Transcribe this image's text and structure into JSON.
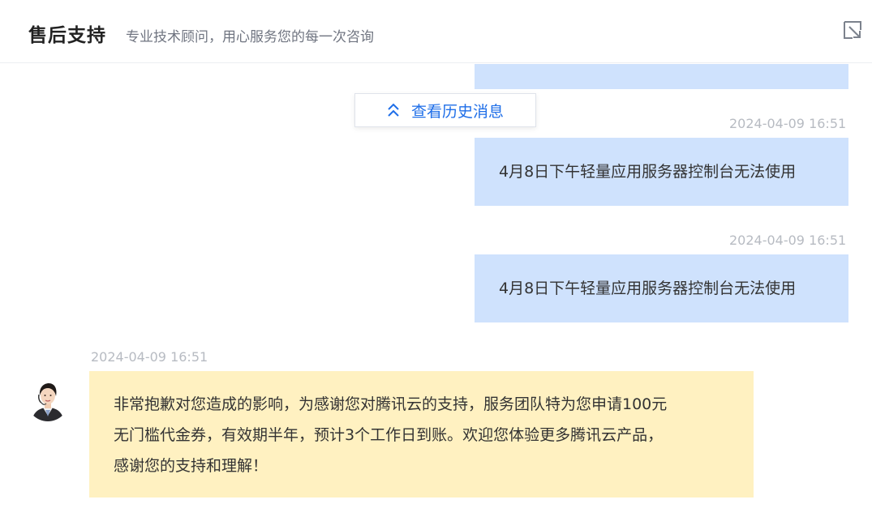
{
  "header": {
    "title": "售后支持",
    "subtitle": "专业技术顾问，用心服务您的每一次咨询",
    "minimize_icon": "minimize-icon"
  },
  "history_button": {
    "label": "查看历史消息",
    "icon": "double-chevron-up-icon"
  },
  "messages": [
    {
      "sender": "user",
      "timestamp": "2024-04-09 16:51",
      "text": "4月8日下午轻量应用服务器控制台无法使用"
    },
    {
      "sender": "user",
      "timestamp": "2024-04-09 16:51",
      "text": "4月8日下午轻量应用服务器控制台无法使用"
    },
    {
      "sender": "agent",
      "timestamp": "2024-04-09 16:51",
      "lines": [
        "非常抱歉对您造成的影响，为感谢您对腾讯云的支持，服务团队特为您申请100元",
        "无门槛代金券，有效期半年，预计3个工作日到账。欢迎您体验更多腾讯云产品，",
        "感谢您的支持和理解！"
      ]
    }
  ],
  "colors": {
    "user_bubble": "#cfe2fd",
    "agent_bubble": "#fff1c1",
    "link": "#1e6ee8",
    "timestamp": "#b7bbc2"
  }
}
